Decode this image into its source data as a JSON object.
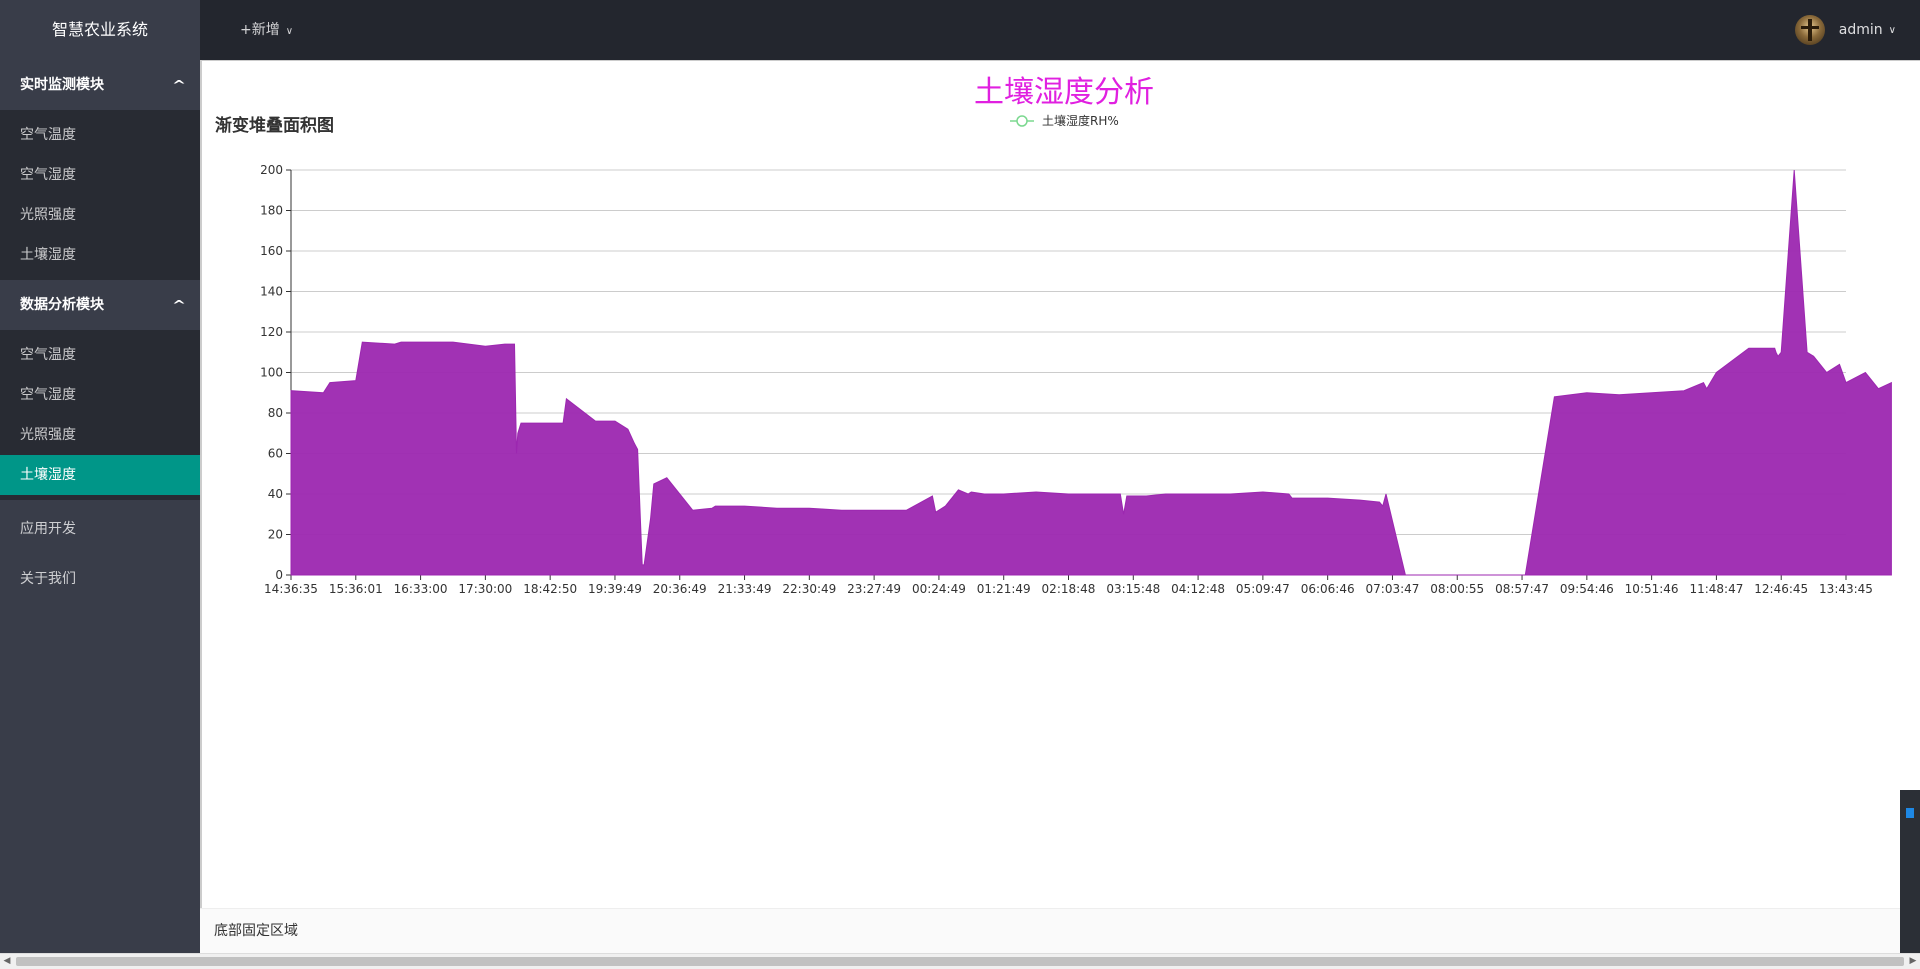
{
  "app": {
    "title": "智慧农业系统"
  },
  "header": {
    "add_label": "+新增",
    "user_name": "admin"
  },
  "sidebar": {
    "groups": [
      {
        "label": "实时监测模块",
        "items": [
          "空气温度",
          "空气湿度",
          "光照强度",
          "土壤湿度"
        ]
      },
      {
        "label": "数据分析模块",
        "items": [
          "空气温度",
          "空气湿度",
          "光照强度",
          "土壤湿度"
        ],
        "active_index": 3
      }
    ],
    "plain_items": [
      "应用开发",
      "关于我们"
    ]
  },
  "card": {
    "title": "渐变堆叠面积图"
  },
  "footer": {
    "text": "底部固定区域"
  },
  "colors": {
    "area": "#9c27b0",
    "title": "#e020e0",
    "active": "#009688"
  },
  "chart_data": {
    "type": "area",
    "title": "土壤湿度分析",
    "legend": [
      "土壤湿度RH%"
    ],
    "legend_position": "top-center",
    "ylim": [
      0,
      200
    ],
    "yticks": [
      0,
      20,
      40,
      60,
      80,
      100,
      120,
      140,
      160,
      180,
      200
    ],
    "xticks": [
      "14:36:35",
      "15:36:01",
      "16:33:00",
      "17:30:00",
      "18:42:50",
      "19:39:49",
      "20:36:49",
      "21:33:49",
      "22:30:49",
      "23:27:49",
      "00:24:49",
      "01:21:49",
      "02:18:48",
      "03:15:48",
      "04:12:48",
      "05:09:47",
      "06:06:46",
      "07:03:47",
      "08:00:55",
      "08:57:47",
      "09:54:46",
      "10:51:46",
      "11:48:47",
      "12:46:45",
      "13:43:45"
    ],
    "grid": true,
    "series": [
      {
        "name": "土壤湿度RH%",
        "x_index": [
          0,
          0.5,
          0.6,
          1,
          1.1,
          1.6,
          1.7,
          2,
          2.5,
          3,
          3.3,
          3.45,
          3.48,
          3.5,
          3.55,
          4.2,
          4.25,
          4.7,
          5,
          5.2,
          5.3,
          5.35,
          5.42,
          5.45,
          5.55,
          5.6,
          5.8,
          6.2,
          6.5,
          6.55,
          6.6,
          6.7,
          7,
          7.5,
          8,
          8.5,
          9,
          9.5,
          9.9,
          9.95,
          10,
          10.1,
          10.3,
          10.45,
          10.5,
          10.7,
          11,
          11.5,
          12,
          12.5,
          12.8,
          12.85,
          12.9,
          13.2,
          13.5,
          14,
          14.5,
          15,
          15.4,
          15.45,
          15.5,
          15.9,
          16,
          16.5,
          16.8,
          16.85,
          16.9,
          17.2,
          17.21,
          17.3,
          17.35,
          17.4,
          17.5,
          18,
          18.5,
          19,
          19.02,
          19.05,
          19.5,
          20,
          20.5,
          21,
          21.5,
          21.8,
          21.85,
          22,
          22.5,
          22.9,
          22.92,
          22.95,
          23,
          23.2,
          23.4,
          23.5,
          23.7,
          23.9,
          24,
          24.3,
          24.5,
          24.7
        ],
        "values": [
          91,
          90,
          95,
          96,
          115,
          114,
          115,
          115,
          115,
          113,
          114,
          114,
          60,
          70,
          75,
          75,
          87,
          76,
          76,
          72,
          65,
          62,
          5,
          5,
          28,
          45,
          48,
          32,
          33,
          34,
          34,
          34,
          34,
          33,
          33,
          32,
          32,
          32,
          39,
          31,
          32,
          34,
          42,
          40,
          41,
          40,
          40,
          41,
          40,
          40,
          40,
          30,
          39,
          39,
          40,
          40,
          40,
          41,
          40,
          38,
          38,
          38,
          38,
          37,
          36,
          34,
          40,
          0,
          0,
          0,
          0,
          0,
          0,
          0,
          0,
          0,
          0,
          0,
          88,
          90,
          89,
          90,
          91,
          95,
          92,
          100,
          112,
          112,
          110,
          108,
          110,
          200,
          110,
          108,
          100,
          104,
          95,
          100,
          92,
          95,
          100,
          103
        ]
      }
    ]
  }
}
